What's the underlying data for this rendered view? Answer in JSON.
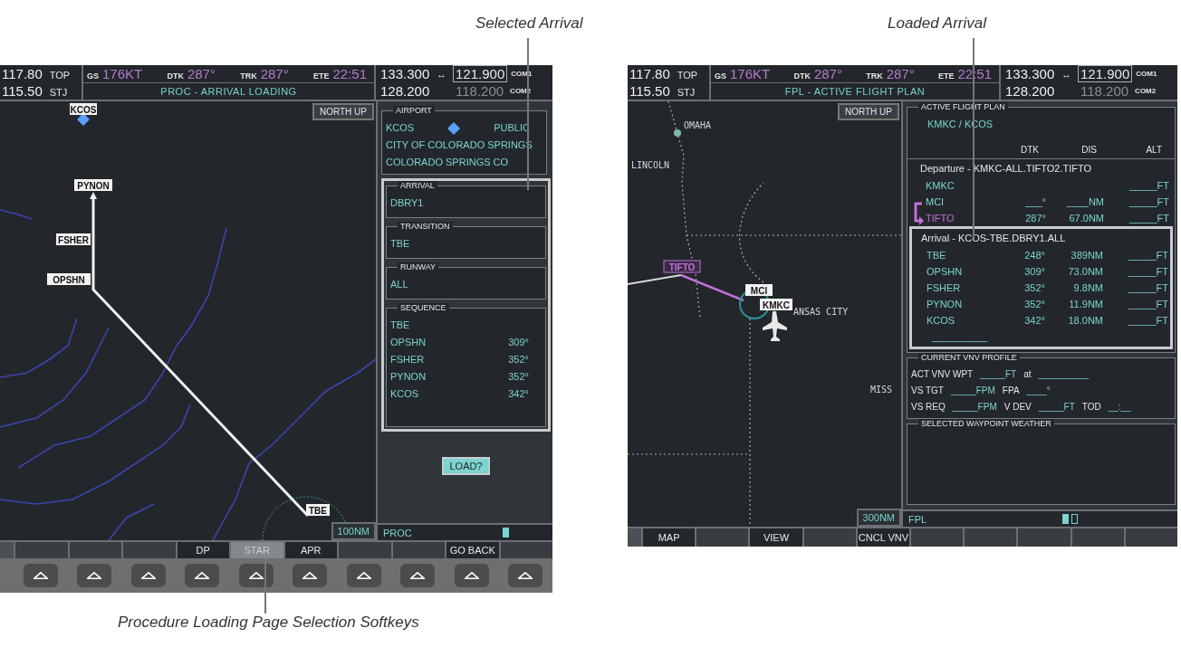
{
  "callouts": {
    "selected_arrival": "Selected Arrival",
    "loaded_arrival": "Loaded Arrival",
    "softkeys": "Procedure Loading Page Selection Softkeys"
  },
  "screens": [
    {
      "kind": "procedure_loading",
      "nav": [
        {
          "freq": "117.80",
          "id": "TOP"
        },
        {
          "freq": "115.50",
          "id": "STJ"
        }
      ],
      "data_bar": [
        {
          "label": "GS",
          "value": "176KT"
        },
        {
          "label": "DTK",
          "value": "287°"
        },
        {
          "label": "TRK",
          "value": "287°"
        },
        {
          "label": "ETE",
          "value": "22:51"
        }
      ],
      "com": [
        {
          "active": "133.300",
          "swap": "↔",
          "standby": "121.900",
          "label": "COM1",
          "selected": true
        },
        {
          "active": "128.200",
          "standby": "118.200",
          "label": "COM2",
          "selected": false
        }
      ],
      "page_title": "PROC - ARRIVAL LOADING",
      "map": {
        "orientation": "NORTH UP",
        "scale": "100NM",
        "waypoints": [
          "KCOS",
          "PYNON",
          "FSHER",
          "OPSHN",
          "TBE"
        ]
      },
      "airport": {
        "title": "AIRPORT",
        "id": "KCOS",
        "type": "PUBLIC",
        "name": "CITY OF COLORADO SPRINGS",
        "city": "COLORADO SPRINGS CO"
      },
      "arrival": {
        "title": "ARRIVAL",
        "value": "DBRY1"
      },
      "transition": {
        "title": "TRANSITION",
        "value": "TBE"
      },
      "runway": {
        "title": "RUNWAY",
        "value": "ALL"
      },
      "sequence": {
        "title": "SEQUENCE",
        "rows": [
          {
            "name": "TBE"
          },
          {
            "name": "OPSHN",
            "course": "309°"
          },
          {
            "name": "FSHER",
            "course": "352°"
          },
          {
            "name": "PYNON",
            "course": "352°"
          },
          {
            "name": "KCOS",
            "course": "342°"
          }
        ]
      },
      "load_button": {
        "label": "LOAD?",
        "selected": true
      },
      "page_group": {
        "label": "PROC",
        "pages": [
          {
            "selected": true
          }
        ]
      },
      "softkeys": [
        {
          "selected": false
        },
        {
          "selected": false
        },
        {
          "selected": false
        },
        {
          "label": "DP",
          "selected": false
        },
        {
          "label": "STAR",
          "selected": true
        },
        {
          "label": "APR",
          "selected": false
        },
        {
          "selected": false
        },
        {
          "selected": false
        },
        {
          "label": "GO BACK",
          "selected": false
        },
        {
          "selected": false
        }
      ]
    },
    {
      "kind": "flight_plan",
      "nav": [
        {
          "freq": "117.80",
          "id": "TOP"
        },
        {
          "freq": "115.50",
          "id": "STJ"
        }
      ],
      "data_bar": [
        {
          "label": "GS",
          "value": "176KT"
        },
        {
          "label": "DTK",
          "value": "287°"
        },
        {
          "label": "TRK",
          "value": "287°"
        },
        {
          "label": "ETE",
          "value": "22:51"
        }
      ],
      "com": [
        {
          "active": "133.300",
          "swap": "↔",
          "standby": "121.900",
          "label": "COM1",
          "selected": true
        },
        {
          "active": "128.200",
          "standby": "118.200",
          "label": "COM2",
          "selected": false
        }
      ],
      "page_title": "FPL - ACTIVE FLIGHT PLAN",
      "map": {
        "orientation": "NORTH UP",
        "scale": "300NM",
        "places": [
          "OMAHA",
          "LINCOLN",
          "MISS",
          "ANSAS CITY"
        ],
        "waypoints": [
          "TIFTO",
          "MCI",
          "KMKC"
        ]
      },
      "flight_plan": {
        "title": "ACTIVE FLIGHT PLAN",
        "route": "KMKC / KCOS",
        "columns": [
          "DTK",
          "DIS",
          "ALT"
        ],
        "departure": {
          "header": "Departure - KMKC-ALL.TIFTO2.TIFTO",
          "rows": [
            {
              "name": "KMKC",
              "alt": "_____FT",
              "active": false
            },
            {
              "name": "MCI",
              "dtk": "___°",
              "dis": "____NM",
              "alt": "_____FT",
              "active": false
            },
            {
              "name": "TIFTO",
              "dtk": "287°",
              "dis": "67.0NM",
              "alt": "_____FT",
              "active": true
            }
          ]
        },
        "arrival": {
          "header": "Arrival - KCOS-TBE.DBRY1.ALL",
          "rows": [
            {
              "name": "TBE",
              "dtk": "248°",
              "dis": "389NM",
              "alt": "_____FT",
              "active": false
            },
            {
              "name": "OPSHN",
              "dtk": "309°",
              "dis": "73.0NM",
              "alt": "_____FT",
              "active": false
            },
            {
              "name": "FSHER",
              "dtk": "352°",
              "dis": "9.8NM",
              "alt": "_____FT",
              "active": false
            },
            {
              "name": "PYNON",
              "dtk": "352°",
              "dis": "11.9NM",
              "alt": "_____FT",
              "active": false
            },
            {
              "name": "KCOS",
              "dtk": "342°",
              "dis": "18.0NM",
              "alt": "_____FT",
              "active": false
            }
          ],
          "end_marker": "__________"
        }
      },
      "vnv": {
        "title": "CURRENT VNV PROFILE",
        "lines": [
          [
            "ACT VNV WPT",
            "_____FT",
            "at",
            "__________"
          ],
          [
            "VS TGT",
            "_____FPM",
            "FPA",
            "____°"
          ],
          [
            "VS REQ",
            "_____FPM",
            "V DEV",
            "_____FT",
            "TOD",
            "__:__"
          ]
        ]
      },
      "weather": {
        "title": "SELECTED WAYPOINT WEATHER"
      },
      "page_group": {
        "label": "FPL",
        "pages": [
          {
            "selected": true
          },
          {
            "selected": false
          }
        ]
      },
      "softkeys": [
        {
          "label": "MAP",
          "selected": false
        },
        {
          "selected": false
        },
        {
          "label": "VIEW",
          "selected": false
        },
        {
          "selected": false
        },
        {
          "label": "CNCL VNV",
          "selected": false
        },
        {
          "selected": false
        },
        {
          "selected": false
        },
        {
          "selected": false
        },
        {
          "selected": false
        },
        {
          "selected": false
        }
      ]
    }
  ]
}
